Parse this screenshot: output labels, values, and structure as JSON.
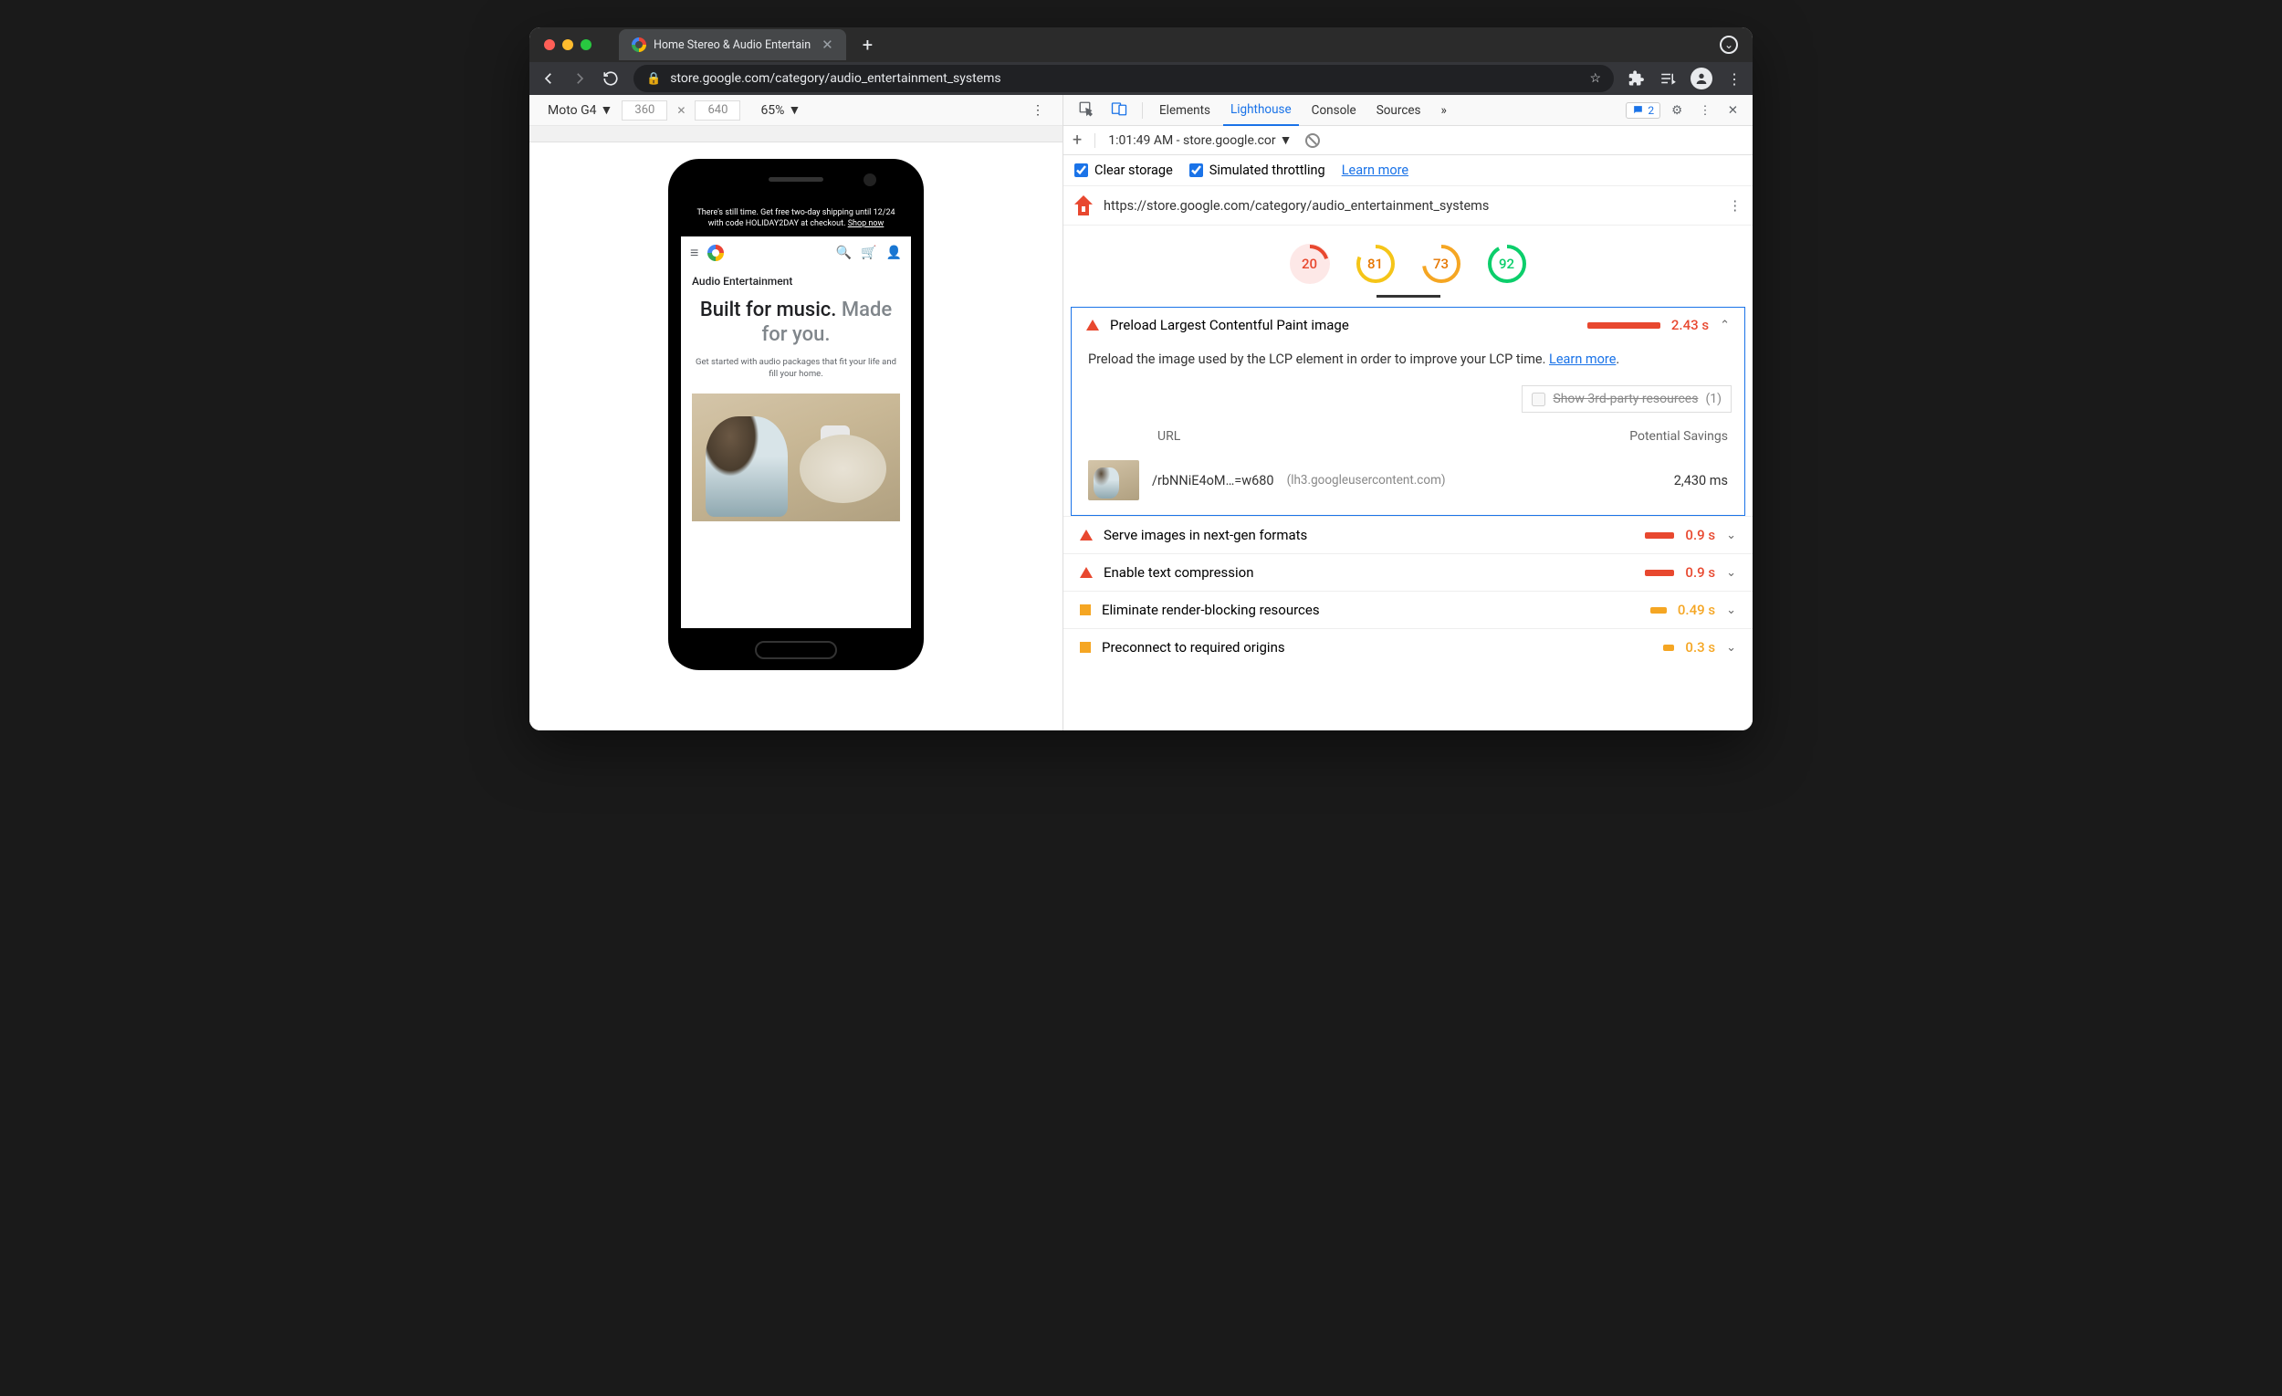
{
  "tab": {
    "title": "Home Stereo & Audio Entertain"
  },
  "url": "store.google.com/category/audio_entertainment_systems",
  "devbar": {
    "device": "Moto G4",
    "w": "360",
    "h": "640",
    "zoom": "65%"
  },
  "devtabs": {
    "elements": "Elements",
    "lighthouse": "Lighthouse",
    "console": "Console",
    "sources": "Sources",
    "more": "»",
    "msgcount": "2"
  },
  "subbar": {
    "timestamp": "1:01:49 AM - store.google.cor"
  },
  "options": {
    "clear": "Clear storage",
    "throttle": "Simulated throttling",
    "learn": "Learn more"
  },
  "audit_url": "https://store.google.com/category/audio_entertainment_systems",
  "scores": {
    "s1": "20",
    "s2": "81",
    "s3": "73",
    "s4": "92"
  },
  "main_audit": {
    "title": "Preload Largest Contentful Paint image",
    "time": "2.43 s",
    "desc": "Preload the image used by the LCP element in order to improve your LCP time. ",
    "learn": "Learn more",
    "third_party": "Show 3rd-party resources",
    "third_count": "(1)",
    "col_url": "URL",
    "col_save": "Potential Savings",
    "res_path": "/rbNNiE4oM…=w680",
    "res_host": "(lh3.googleusercontent.com)",
    "res_save": "2,430 ms"
  },
  "audits": [
    {
      "sev": "tri",
      "title": "Serve images in next-gen formats",
      "barw": 32,
      "color": "red",
      "time": "0.9 s"
    },
    {
      "sev": "tri",
      "title": "Enable text compression",
      "barw": 32,
      "color": "red",
      "time": "0.9 s"
    },
    {
      "sev": "sq",
      "title": "Eliminate render-blocking resources",
      "barw": 18,
      "color": "org",
      "time": "0.49 s"
    },
    {
      "sev": "sq",
      "title": "Preconnect to required origins",
      "barw": 12,
      "color": "org",
      "time": "0.3 s"
    }
  ],
  "mock": {
    "banner_1": "There's still time. Get free two-day shipping until 12/24 with code HOLIDAY2DAY at checkout. ",
    "banner_link": "Shop now",
    "category": "Audio Entertainment",
    "h1a": "Built for music.",
    "h1b": "Made for you.",
    "sub": "Get started with audio packages that fit your life and fill your home."
  }
}
